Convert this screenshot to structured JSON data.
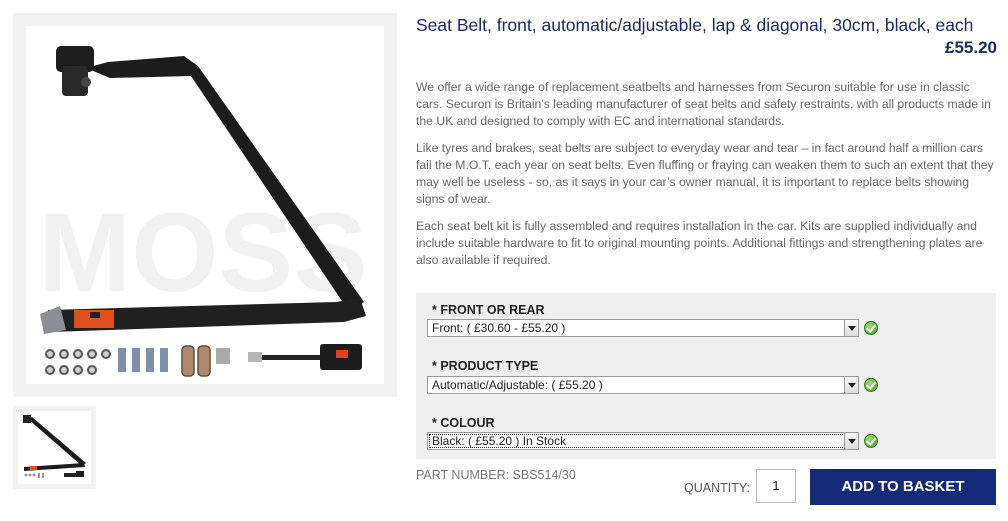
{
  "product": {
    "title": "Seat Belt, front, automatic/adjustable, lap & diagonal, 30cm, black, each",
    "price": "£55.20",
    "watermark": "MOSS"
  },
  "description": {
    "p1": "We offer a wide range of replacement seatbelts and harnesses from Securon suitable for use in classic cars. Securon is Britain’s leading manufacturer of seat belts and safety restraints, with all products made in the UK and designed to comply with EC and international standards.",
    "p2": "Like tyres and brakes, seat belts are subject to everyday wear and tear – in fact around half a million cars fail the M.O.T. each year on seat belts. Even fluffing or fraying can weaken them to such an extent that they may well be useless - so, as it says in your car’s owner manual, it is important to replace belts showing signs of wear.",
    "p3": "Each seat belt kit is fully assembled and requires installation in the car. Kits are supplied individually and include suitable hardware to fit to original mounting points. Additional fittings and strengthening plates are also available if required."
  },
  "options": [
    {
      "label": "* FRONT OR REAR",
      "selected": "Front: ( £30.60 - £55.20 )"
    },
    {
      "label": "* PRODUCT TYPE",
      "selected": "Automatic/Adjustable: ( £55.20 )"
    },
    {
      "label": "* COLOUR",
      "selected": "Black: ( £55.20 ) In Stock"
    }
  ],
  "part_number": "PART NUMBER: SBS514/30",
  "purchase": {
    "quantity_label": "QUANTITY:",
    "quantity_value": "1",
    "add_button": "ADD TO BASKET"
  },
  "colors": {
    "brand_navy": "#142a7a",
    "title_navy": "#1a2a6c",
    "check_green": "#3c9a1f"
  },
  "icons": [
    "check-icon",
    "dropdown-arrow-icon"
  ]
}
